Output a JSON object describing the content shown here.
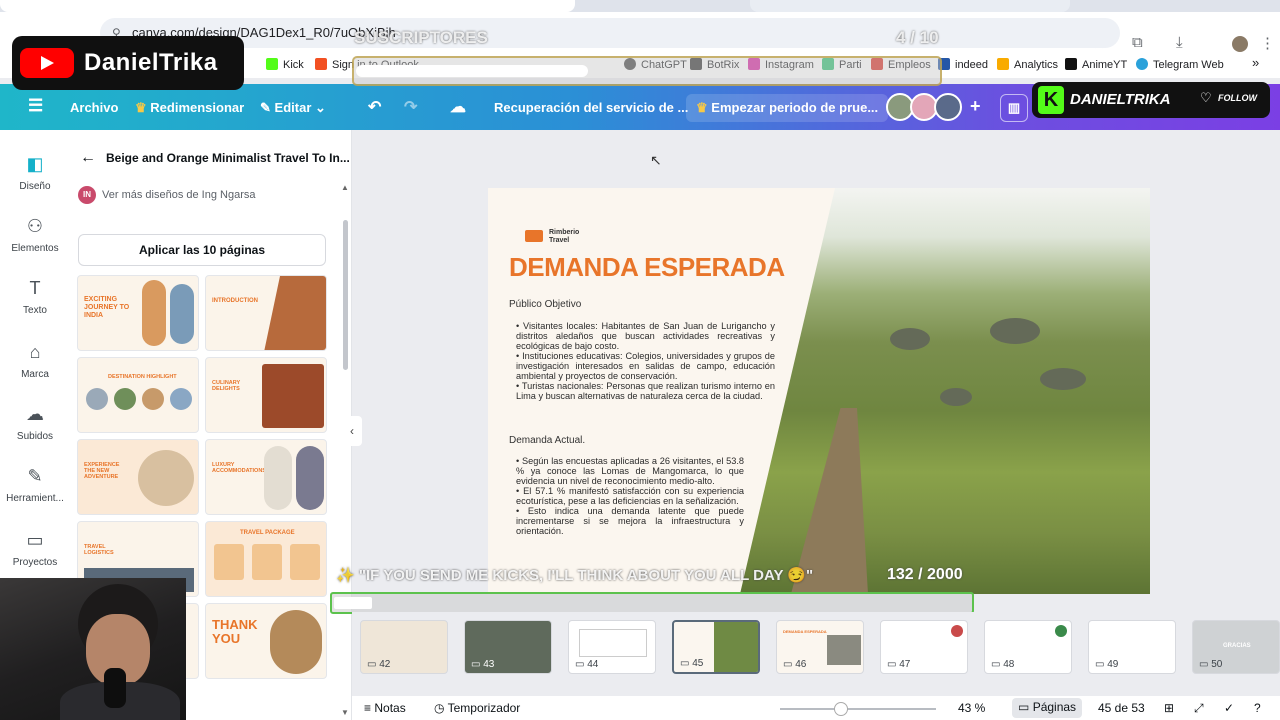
{
  "browser": {
    "url": "canva.com/design/DAG1Dex1_R0/7uObXiBjh",
    "bookmarks": [
      {
        "label": "Kick",
        "color": "#53fc18"
      },
      {
        "label": "Sign in to Outlook",
        "color": "#f25022"
      },
      {
        "label": "ChatGPT",
        "color": "#444"
      },
      {
        "label": "BotRix",
        "color": "#333"
      },
      {
        "label": "Instagram",
        "color": "#d6249f"
      },
      {
        "label": "Parti",
        "color": "#2fbf71"
      },
      {
        "label": "Empleos",
        "color": "#d93025"
      },
      {
        "label": "indeed",
        "color": "#2557a7"
      },
      {
        "label": "Analytics",
        "color": "#f9ab00"
      },
      {
        "label": "AnimeYT",
        "color": "#111"
      },
      {
        "label": "Telegram Web",
        "color": "#2aa1da"
      }
    ]
  },
  "overlay": {
    "channel_name": "DanielTrika",
    "subscribers_label": "SUSCRIPTORES",
    "subscribers_count": "4 / 10",
    "kick_name": "DANIELTRIKA",
    "follow_label": "FOLLOW",
    "kicks_message": "\"IF YOU SEND ME KICKS, I'LL THINK ABOUT YOU ALL DAY 😏\"",
    "kicks_count": "132 / 2000"
  },
  "header": {
    "file_label": "Archivo",
    "resize_label": "Redimensionar",
    "edit_label": "Editar",
    "status_label": "Recuperación del servicio de ...",
    "trial_label": "Empezar periodo de prue..."
  },
  "rail": [
    {
      "label": "Diseño",
      "icon": "design-icon"
    },
    {
      "label": "Elementos",
      "icon": "elements-icon"
    },
    {
      "label": "Texto",
      "icon": "text-icon"
    },
    {
      "label": "Marca",
      "icon": "brand-icon"
    },
    {
      "label": "Subidos",
      "icon": "upload-icon"
    },
    {
      "label": "Herramient...",
      "icon": "tools-icon"
    },
    {
      "label": "Proyectos",
      "icon": "folder-icon"
    }
  ],
  "panel": {
    "template_title": "Beige and Orange Minimalist Travel To In...",
    "author_initials": "IN",
    "author_link": "Ver más diseños de Ing Ngarsa",
    "apply_button": "Aplicar las 10 páginas",
    "thumbnails": [
      {
        "title": "EXCITING JOURNEY TO INDIA"
      },
      {
        "title": "INTRODUCTION"
      },
      {
        "title": "DESTINATION HIGHLIGHT"
      },
      {
        "title": "CULINARY DELIGHTS"
      },
      {
        "title": "EXPERIENCE THE NEW ADVENTURE"
      },
      {
        "title": "LUXURY ACCOMMODATIONS"
      },
      {
        "title": "TRAVEL LOGISTICS"
      },
      {
        "title": "TRAVEL PACKAGE"
      },
      {
        "title": ""
      },
      {
        "title": "THANK YOU"
      }
    ]
  },
  "slide": {
    "brand": "Rimberio Travel",
    "title": "DEMANDA ESPERADA",
    "section1": "Público Objetivo",
    "bullets1": [
      "Visitantes locales: Habitantes de San Juan de Lurigancho y distritos aledaños que buscan actividades recreativas y ecológicas de bajo costo.",
      "Instituciones educativas: Colegios, universidades y grupos de investigación interesados en salidas de campo, educación ambiental y proyectos de conservación.",
      "Turistas nacionales: Personas que realizan turismo interno en Lima y buscan alternativas de naturaleza cerca de la ciudad."
    ],
    "section2": "Demanda Actual.",
    "bullets2": [
      "Según las encuestas aplicadas a 26 visitantes, el 53.8 % ya conoce las Lomas de Mangomarca, lo que evidencia un nivel de reconocimiento medio-alto.",
      "El 57.1 % manifestó satisfacción con su experiencia ecoturística, pese a las deficiencias en la señalización.",
      "Esto indica una demanda latente que puede incrementarse si se mejora la infraestructura y orientación."
    ]
  },
  "pages": [
    {
      "num": "42"
    },
    {
      "num": "43"
    },
    {
      "num": "44"
    },
    {
      "num": "45",
      "active": true
    },
    {
      "num": "46"
    },
    {
      "num": "47"
    },
    {
      "num": "48"
    },
    {
      "num": "49"
    },
    {
      "num": "50"
    }
  ],
  "page_titles": {
    "p46": "DEMANDA ESPERADA",
    "p50": "GRACIAS"
  },
  "footer": {
    "notes_label": "Notas",
    "timer_label": "Temporizador",
    "zoom": "43 %",
    "pages_label": "Páginas",
    "page_counter": "45 de 53"
  },
  "colors": {
    "accent": "#e8752a",
    "kick_green": "#53fc18"
  }
}
